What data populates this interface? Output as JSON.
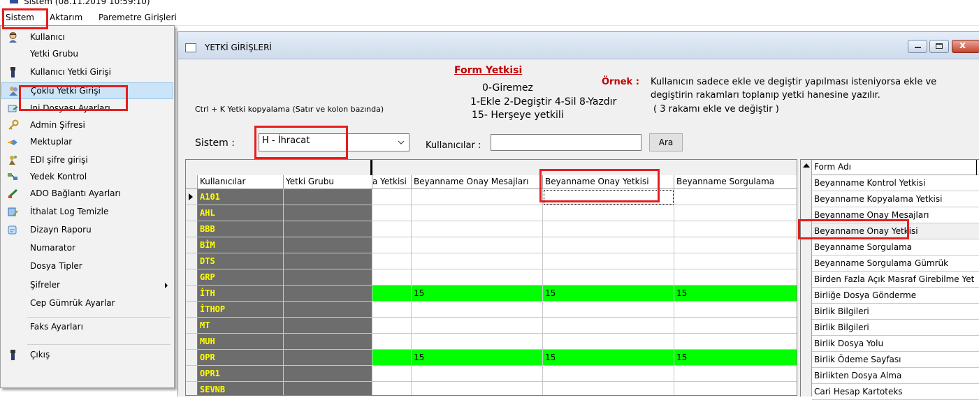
{
  "window": {
    "title": "Sistem (08.11.2019 10:59:10)"
  },
  "menubar": [
    "Sistem",
    "Aktarım",
    "Paremetre Girişleri"
  ],
  "dropdown": {
    "items": [
      {
        "label": "Kullanıcı",
        "icon": "user-icon"
      },
      {
        "label": "Yetki Grubu",
        "icon": ""
      },
      {
        "label": "Kullanıcı Yetki Girişi",
        "icon": "person-icon"
      },
      {
        "label": "Çoklu Yetki Girişi",
        "icon": "multi-user-icon"
      },
      {
        "label": "Ini Dosyası Ayarları",
        "icon": "ini-file-icon"
      },
      {
        "label": "Admin Şifresi",
        "icon": "key-icon"
      },
      {
        "label": "Mektuplar",
        "icon": "letter-icon"
      },
      {
        "label": "EDI şifre girişi",
        "icon": "edi-icon"
      },
      {
        "label": "Yedek Kontrol",
        "icon": "backup-icon"
      },
      {
        "label": "ADO Bağlantı Ayarları",
        "icon": "connection-icon"
      },
      {
        "label": "İthalat Log Temizle",
        "icon": "clean-log-icon"
      },
      {
        "label": "Dizayn Raporu",
        "icon": "report-icon"
      },
      {
        "label": "Numarator",
        "icon": ""
      },
      {
        "label": "Dosya Tipler",
        "icon": ""
      },
      {
        "label": "Şifreler",
        "icon": "",
        "submenu": true
      },
      {
        "label": "Cep Gümrük Ayarlar",
        "icon": ""
      },
      {
        "label": "Faks Ayarları",
        "icon": ""
      },
      {
        "label": "Çıkış",
        "icon": "exit-icon"
      }
    ]
  },
  "child": {
    "title": "YETKİ GİRİŞLERİ",
    "hint": "Ctrl + K Yetki kopyalama (Satır ve kolon bazında)",
    "form_yetkisi": {
      "title": "Form Yetkisi",
      "lines": [
        "0-Giremez",
        "1-Ekle  2-Degiştir  4-Sil  8-Yazdır",
        "15- Herşeye yetkili"
      ]
    },
    "ornek": {
      "label": "Örnek :",
      "text1": "Kullanıcın sadece ekle ve degiştir yapılması isteniyorsa  ekle ve",
      "text2": "degiştirin rakamları toplanıp yetki hanesine yazılır.",
      "text3": "( 3 rakamı ekle ve değiştir )"
    },
    "sistem_label": "Sistem :",
    "sistem_value": "H - İhracat",
    "kullanicilar_label": "Kullanıcılar :",
    "kullanicilar_value": "",
    "ara_label": "Ara"
  },
  "grid": {
    "headers": [
      "Kullanıcılar",
      "Yetki Grubu",
      "a Yetkisi",
      "Beyanname Onay Mesajları",
      "Beyanname Onay Yetkisi",
      "Beyanname Sorgulama"
    ],
    "rows": [
      {
        "user": "A101",
        "vals": [
          "",
          "",
          "",
          ""
        ],
        "green": false,
        "current": true
      },
      {
        "user": "AHL",
        "vals": [
          "",
          "",
          "",
          ""
        ],
        "green": false
      },
      {
        "user": "BBB",
        "vals": [
          "",
          "",
          "",
          ""
        ],
        "green": false
      },
      {
        "user": "BİM",
        "vals": [
          "",
          "",
          "",
          ""
        ],
        "green": false
      },
      {
        "user": "DTS",
        "vals": [
          "",
          "",
          "",
          ""
        ],
        "green": false
      },
      {
        "user": "GRP",
        "vals": [
          "",
          "",
          "",
          ""
        ],
        "green": false
      },
      {
        "user": "İTH",
        "vals": [
          "",
          "15",
          "15",
          "15"
        ],
        "green": true
      },
      {
        "user": "İTHOP",
        "vals": [
          "",
          "",
          "",
          ""
        ],
        "green": false
      },
      {
        "user": "MT",
        "vals": [
          "",
          "",
          "",
          ""
        ],
        "green": false
      },
      {
        "user": "MUH",
        "vals": [
          "",
          "",
          "",
          ""
        ],
        "green": false
      },
      {
        "user": "OPR",
        "vals": [
          "",
          "15",
          "15",
          "15"
        ],
        "green": true
      },
      {
        "user": "OPR1",
        "vals": [
          "",
          "",
          "",
          ""
        ],
        "green": false
      },
      {
        "user": "SEVNB",
        "vals": [
          "",
          "",
          "",
          ""
        ],
        "green": false
      }
    ]
  },
  "form_list": {
    "header": "Form Adı",
    "items": [
      "Beyanname Kontrol Yetkisi",
      "Beyanname Kopyalama Yetkisi",
      "Beyanname Onay Mesajları",
      "Beyanname Onay Yetkisi",
      "Beyanname Sorgulama",
      "Beyanname Sorgulama Gümrük",
      "Birden Fazla Açık Masraf Girebilme Yet",
      "Birliğe Dosya Gönderme",
      "Birlik Bilgileri",
      "Birlik Bilgileri",
      "Birlik Dosya Yolu",
      "Birlik Ödeme Sayfası",
      "Birlikten Dosya Alma",
      "Cari Hesap Kartoteks"
    ]
  },
  "colors": {
    "green": "#00ff00",
    "user_text": "#ffff00",
    "highlight_box": "#e51e1e",
    "form_title": "#c00000"
  }
}
